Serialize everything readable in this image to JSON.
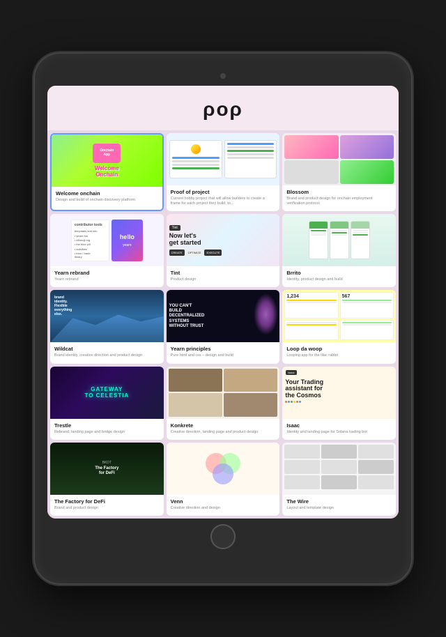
{
  "app": {
    "logo": "ρoρ",
    "background_color": "#f5e8f0"
  },
  "cards": [
    {
      "id": "welcome-onchain",
      "title": "Welcome onchain",
      "description": "Design and build of onchain discovery platform",
      "thumb_type": "welcome"
    },
    {
      "id": "proof-of-project",
      "title": "Proof of project",
      "description": "Current hobby project that will allow builders to create a frame for each project they build, to...",
      "thumb_type": "proof"
    },
    {
      "id": "blossom",
      "title": "Blossom",
      "description": "Brand and product design for onchain employment verification protocol",
      "thumb_type": "blossom"
    },
    {
      "id": "yearn-rebrand",
      "title": "Yearn rebrand",
      "description": "Yearn rebrand",
      "thumb_type": "yearn"
    },
    {
      "id": "tint",
      "title": "Tint",
      "description": "Product design",
      "thumb_type": "tint"
    },
    {
      "id": "brrito",
      "title": "Brrito",
      "description": "Identity, product design and build",
      "thumb_type": "brrito"
    },
    {
      "id": "wildcat",
      "title": "Wildcat",
      "description": "Brand identity, creative direction and product design",
      "thumb_type": "wildcat"
    },
    {
      "id": "yearn-principles",
      "title": "Yearn principles",
      "description": "Pure html and css – design and build",
      "thumb_type": "yearnp"
    },
    {
      "id": "loop-da-woop",
      "title": "Loop da woop",
      "description": "Looping app for the lilac rabbit",
      "thumb_type": "loop"
    },
    {
      "id": "trestle",
      "title": "Trestle",
      "description": "Rebrand, landing page and bridge design",
      "thumb_type": "trestle"
    },
    {
      "id": "konkrete",
      "title": "Konkrete",
      "description": "Creative direction, landing page and product design",
      "thumb_type": "konkrete"
    },
    {
      "id": "isaac",
      "title": "Isaac",
      "description": "Identity and landing page for Solana trading bot",
      "thumb_type": "isaac",
      "thumb_text": "Your Trading assistant for the Cosmos"
    },
    {
      "id": "factory-defi",
      "title": "The Factory for DeFi",
      "description": "Brand and product design",
      "thumb_type": "factory"
    },
    {
      "id": "venn",
      "title": "Venn",
      "description": "Creative direction and design",
      "thumb_type": "venn"
    },
    {
      "id": "last",
      "title": "The Wire",
      "description": "Layout and template design",
      "thumb_type": "last"
    }
  ]
}
